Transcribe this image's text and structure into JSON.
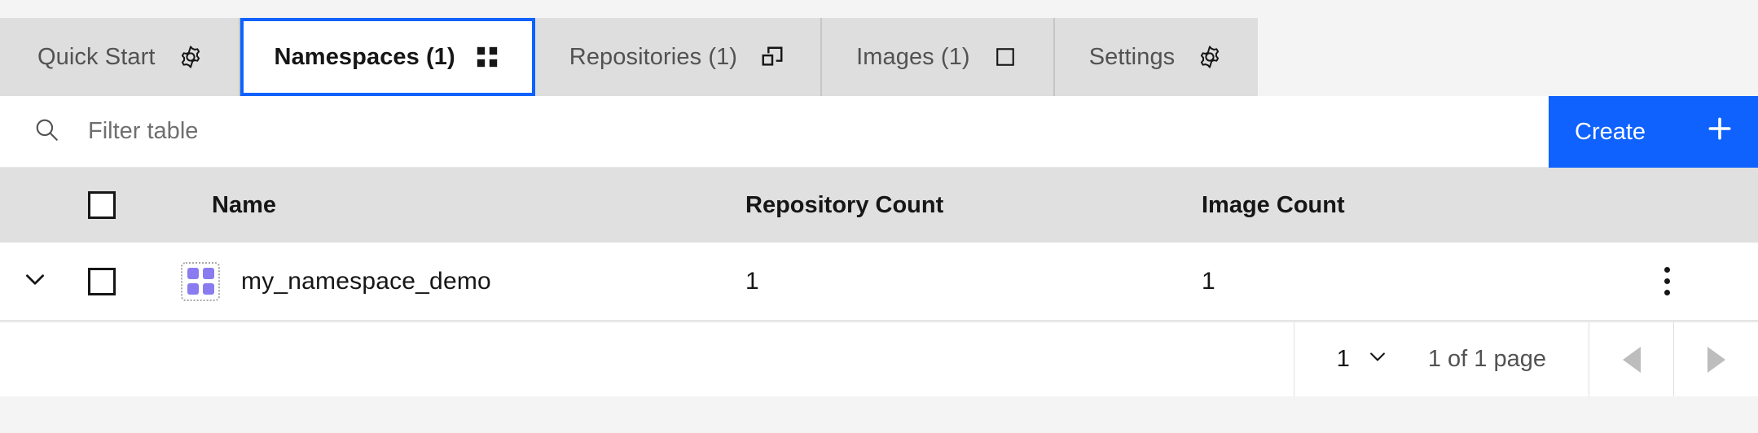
{
  "theme": {
    "accent_blue": "#0f62fe",
    "tab_bg": "#dedede",
    "page_bg": "#f4f4f4",
    "header_row_bg": "#e0e0e0",
    "namespace_icon_purple": "#8a7cf0"
  },
  "tabs": [
    {
      "label": "Quick Start",
      "icon": "gear-icon",
      "selected": false
    },
    {
      "label": "Namespaces (1)",
      "icon": "grid-icon",
      "selected": true
    },
    {
      "label": "Repositories (1)",
      "icon": "repository-icon",
      "selected": false
    },
    {
      "label": "Images (1)",
      "icon": "square-icon",
      "selected": false
    },
    {
      "label": "Settings",
      "icon": "gear-icon",
      "selected": false
    }
  ],
  "toolbar": {
    "search_placeholder": "Filter table",
    "search_value": "",
    "search_icon": "search-icon",
    "settings_icon": "gear-icon",
    "create_label": "Create",
    "create_icon": "plus-icon"
  },
  "table": {
    "columns": [
      "Name",
      "Repository Count",
      "Image Count"
    ],
    "rows": [
      {
        "name": "my_namespace_demo",
        "repository_count": "1",
        "image_count": "1",
        "icon": "namespace-grid-icon",
        "expand_icon": "chevron-down-icon",
        "menu_icon": "overflow-menu-icon"
      }
    ]
  },
  "pagination": {
    "page_size": "1",
    "page_size_icon": "chevron-down-icon",
    "page_info": "1 of 1 page",
    "prev_icon": "caret-left-icon",
    "next_icon": "caret-right-icon"
  }
}
